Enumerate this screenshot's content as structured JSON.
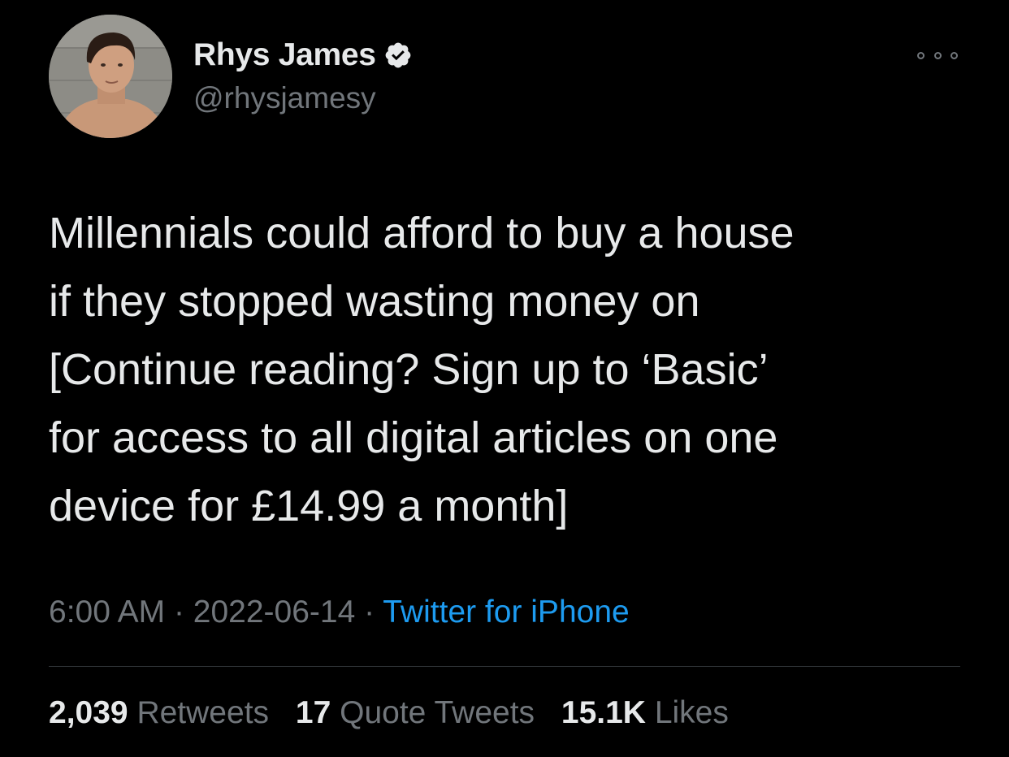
{
  "author": {
    "display_name": "Rhys James",
    "handle": "@rhysjamesy",
    "verified": true
  },
  "tweet": {
    "lines": [
      "Millennials could afford to buy a house",
      "if they stopped wasting money on",
      "[Continue reading? Sign up to ‘Basic’",
      "for access to all digital articles on one",
      "device for £14.99 a month]"
    ],
    "time": "6:00 AM",
    "date": "2022-06-14",
    "separator": "·",
    "source": "Twitter for iPhone"
  },
  "stats": {
    "retweets_count": "2,039",
    "retweets_label": "Retweets",
    "quotes_count": "17",
    "quotes_label": "Quote Tweets",
    "likes_count": "15.1K",
    "likes_label": "Likes"
  },
  "colors": {
    "background": "#000000",
    "primary_text": "#e7e9ea",
    "secondary_text": "#71767b",
    "link": "#1d9bf0",
    "divider": "#2f3336"
  },
  "icons": {
    "verified": "verified-badge-icon",
    "more": "more-horizontal-icon"
  }
}
